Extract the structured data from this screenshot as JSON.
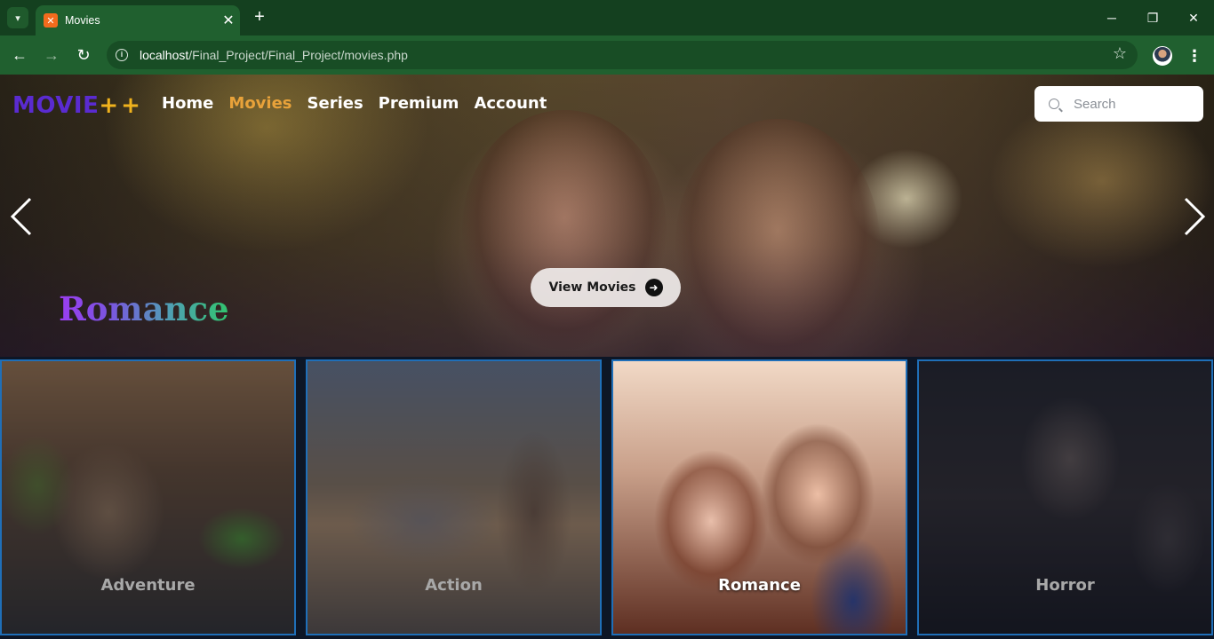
{
  "browser": {
    "tab_title": "Movies",
    "tab_favicon": "xampp-icon",
    "url_host": "localhost",
    "url_path": "/Final_Project/Final_Project/movies.php"
  },
  "site": {
    "logo_main": "MOVIE",
    "logo_plus": "++",
    "nav": [
      {
        "label": "Home"
      },
      {
        "label": "Movies",
        "active": true
      },
      {
        "label": "Series"
      },
      {
        "label": "Premium"
      },
      {
        "label": "Account"
      }
    ],
    "search_placeholder": "Search"
  },
  "hero": {
    "button_label": "View Movies",
    "genre_title": "Romance"
  },
  "genres": [
    {
      "label": "Adventure"
    },
    {
      "label": "Action"
    },
    {
      "label": "Romance",
      "active": true
    },
    {
      "label": "Horror"
    }
  ],
  "colors": {
    "logo_purple": "#5a2bd0",
    "logo_yellow": "#f0b21d",
    "nav_active": "#e8a23a",
    "card_border": "#1f6fb8"
  }
}
